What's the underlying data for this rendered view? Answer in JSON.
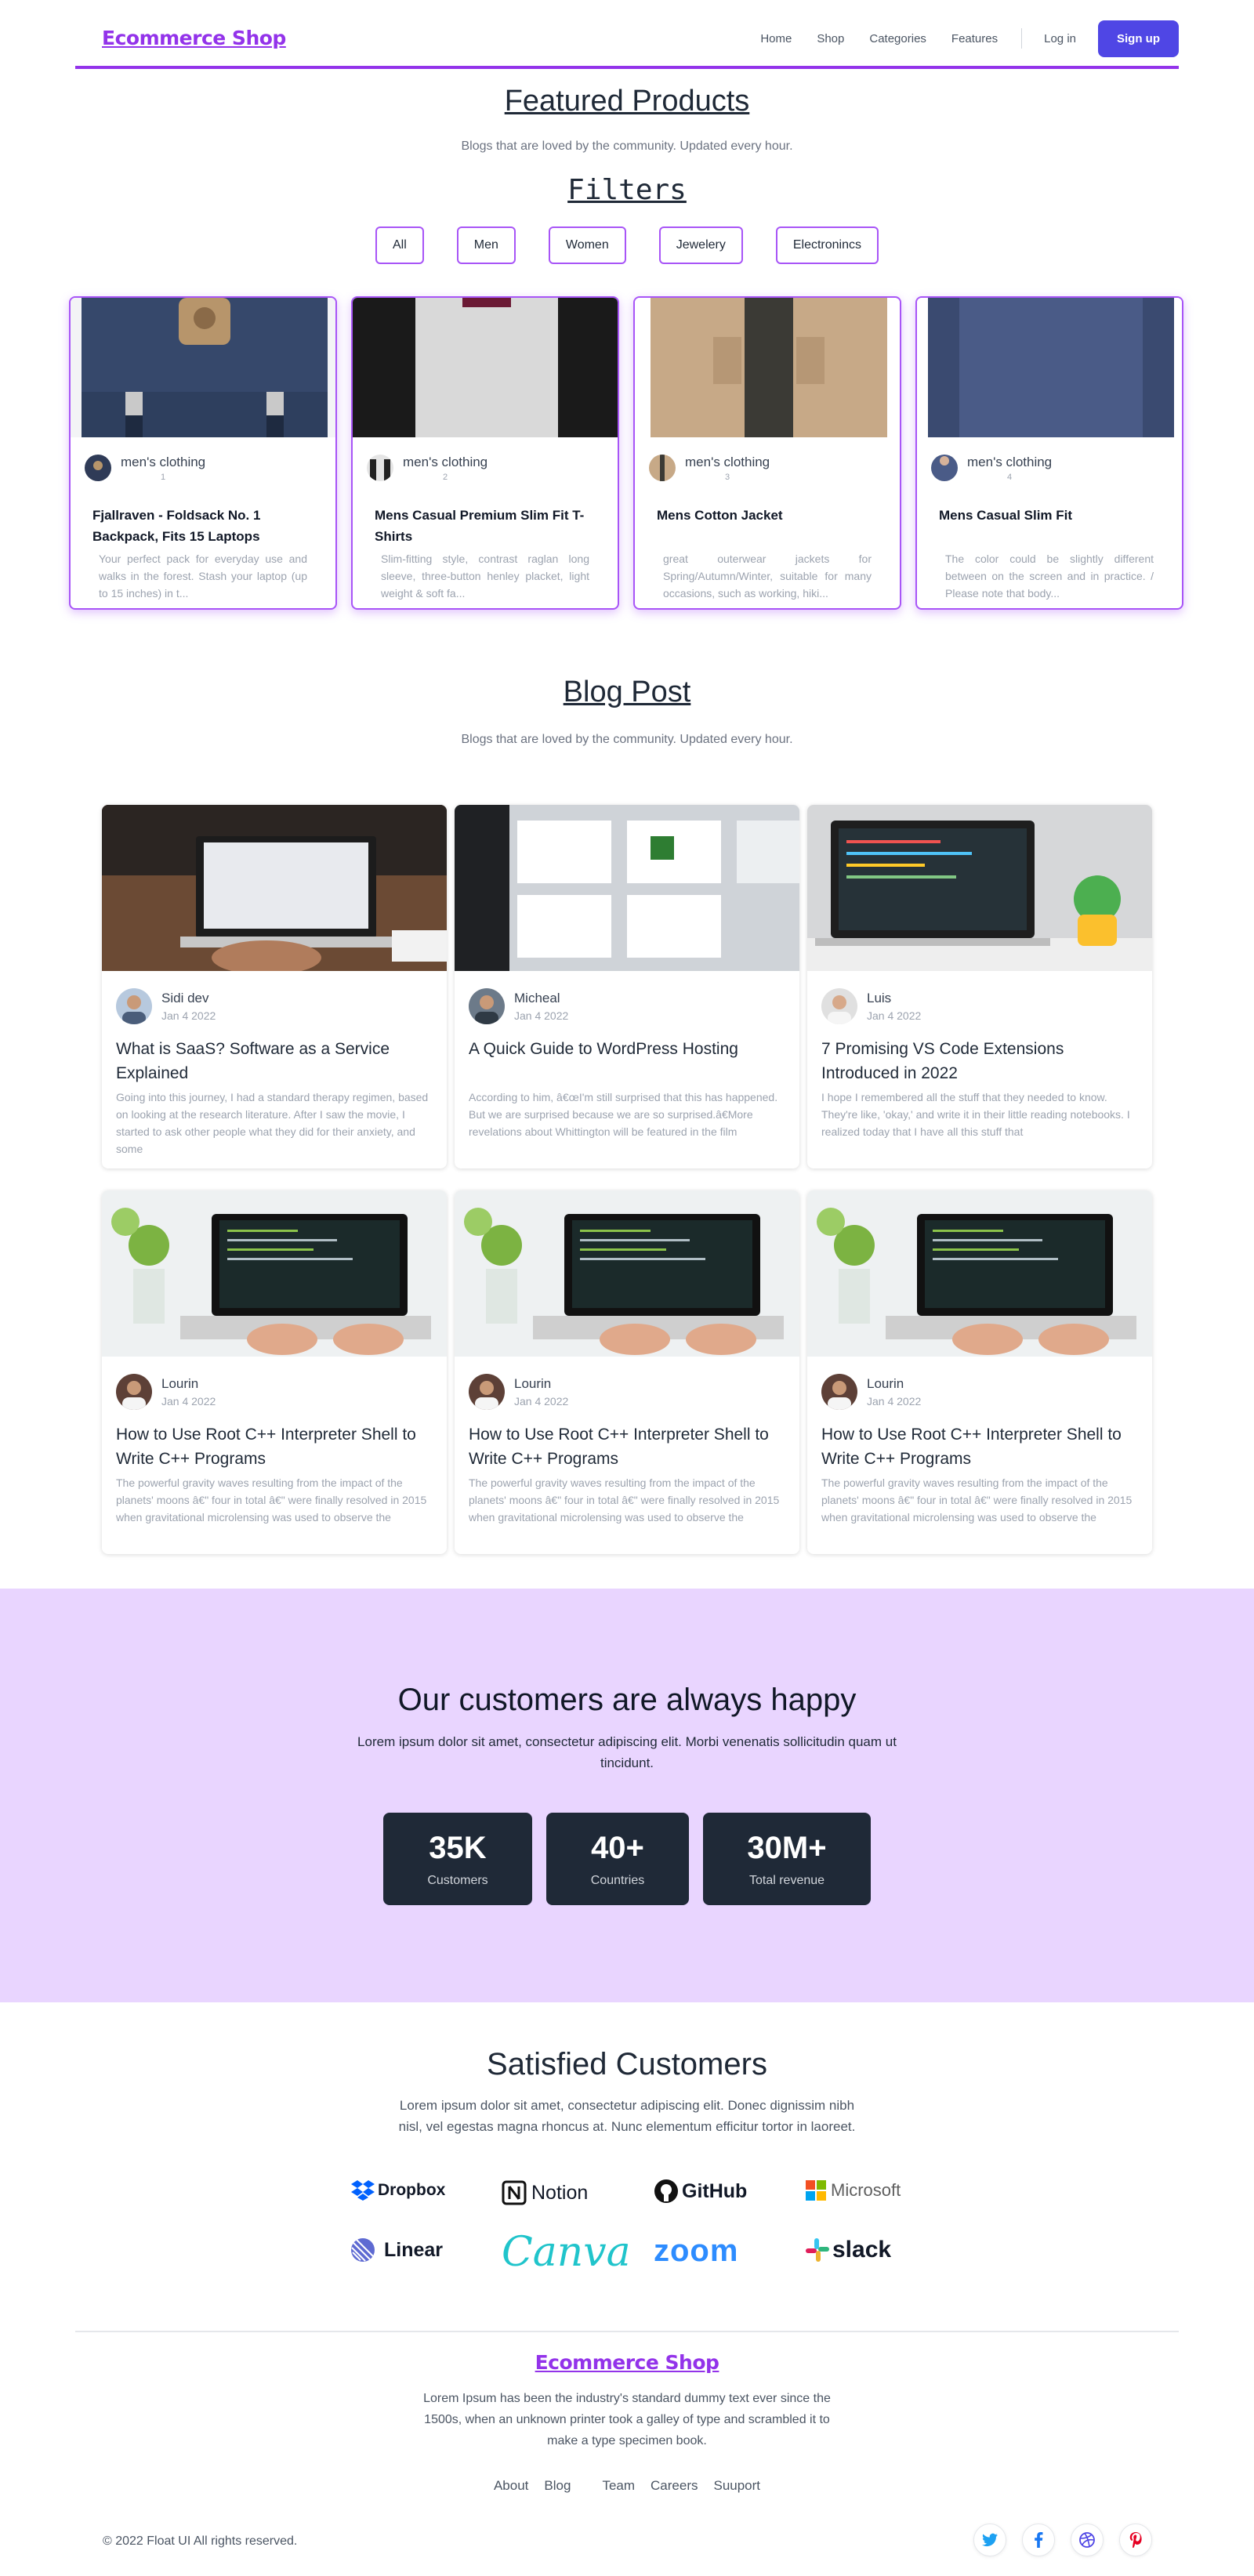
{
  "nav": {
    "brand": "Ecommerce Shop",
    "links": [
      "Home",
      "Shop",
      "Categories",
      "Features"
    ],
    "login": "Log in",
    "signup": "Sign up"
  },
  "featured": {
    "title": "Featured Products",
    "subtitle": "Blogs that are loved by the community. Updated every hour."
  },
  "filters": {
    "title": "Filters",
    "items": [
      "All",
      "Men",
      "Women",
      "Jewelery",
      "Electronincs"
    ]
  },
  "products": [
    {
      "category": "men's clothing",
      "id": "1",
      "title": "Fjallraven - Foldsack No. 1 Backpack, Fits 15 Laptops",
      "desc": "Your perfect pack for everyday use and walks in the forest. Stash your laptop (up to 15 inches) in t..."
    },
    {
      "category": "men's clothing",
      "id": "2",
      "title": "Mens Casual Premium Slim Fit T-Shirts",
      "desc": "Slim-fitting style, contrast raglan long sleeve, three-button henley placket, light weight & soft fa..."
    },
    {
      "category": "men's clothing",
      "id": "3",
      "title": "Mens Cotton Jacket",
      "desc": "great outerwear jackets for Spring/Autumn/Winter, suitable for many occasions, such as working, hiki..."
    },
    {
      "category": "men's clothing",
      "id": "4",
      "title": "Mens Casual Slim Fit",
      "desc": "The color could be slightly different between on the screen and in practice. / Please note that body..."
    }
  ],
  "blog": {
    "title": "Blog Post",
    "subtitle": "Blogs that are loved by the community. Updated every hour.",
    "posts": [
      {
        "author": "Sidi dev",
        "date": "Jan 4 2022",
        "title": "What is SaaS? Software as a Service Explained",
        "desc": "Going into this journey, I had a standard therapy regimen, based on looking at the research literature. After I saw the movie, I started to ask other people what they did for their anxiety, and some"
      },
      {
        "author": "Micheal",
        "date": "Jan 4 2022",
        "title": "A Quick Guide to WordPress Hosting",
        "desc": "According to him, â€œI'm still surprised that this has happened. But we are surprised because we are so surprised.â€More revelations about Whittington will be featured in the film"
      },
      {
        "author": "Luis",
        "date": "Jan 4 2022",
        "title": "7 Promising VS Code Extensions Introduced in 2022",
        "desc": "I hope I remembered all the stuff that they needed to know. They're like, 'okay,' and write it in their little reading notebooks. I realized today that I have all this stuff that"
      },
      {
        "author": "Lourin",
        "date": "Jan 4 2022",
        "title": "How to Use Root C++ Interpreter Shell to Write C++ Programs",
        "desc": "The powerful gravity waves resulting from the impact of the planets' moons â€\" four in total â€\" were finally resolved in 2015 when gravitational microlensing was used to observe the"
      },
      {
        "author": "Lourin",
        "date": "Jan 4 2022",
        "title": "How to Use Root C++ Interpreter Shell to Write C++ Programs",
        "desc": "The powerful gravity waves resulting from the impact of the planets' moons â€\" four in total â€\" were finally resolved in 2015 when gravitational microlensing was used to observe the"
      },
      {
        "author": "Lourin",
        "date": "Jan 4 2022",
        "title": "How to Use Root C++ Interpreter Shell to Write C++ Programs",
        "desc": "The powerful gravity waves resulting from the impact of the planets' moons â€\" four in total â€\" were finally resolved in 2015 when gravitational microlensing was used to observe the"
      }
    ]
  },
  "stats": {
    "title": "Our customers are always happy",
    "text": "Lorem ipsum dolor sit amet, consectetur adipiscing elit. Morbi venenatis sollicitudin quam ut tincidunt.",
    "items": [
      {
        "value": "35K",
        "label": "Customers"
      },
      {
        "value": "40+",
        "label": "Countries"
      },
      {
        "value": "30M+",
        "label": "Total revenue"
      }
    ]
  },
  "customers": {
    "title": "Satisfied Customers",
    "text": "Lorem ipsum dolor sit amet, consectetur adipiscing elit. Donec dignissim nibh nisl, vel egestas magna rhoncus at. Nunc elementum efficitur tortor in laoreet.",
    "logos": [
      "Dropbox",
      "Notion",
      "GitHub",
      "Microsoft",
      "Linear",
      "Canva",
      "zoom",
      "slack"
    ]
  },
  "footer": {
    "brand": "Ecommerce Shop",
    "text": "Lorem Ipsum has been the industry's standard dummy text ever since the 1500s, when an unknown printer took a galley of type and scrambled it to make a type specimen book.",
    "links": [
      "About",
      "Blog",
      "",
      "Team",
      "Careers",
      "Suuport"
    ],
    "copyright": "© 2022 Float UI All rights reserved.",
    "socials": [
      "twitter-icon",
      "facebook-icon",
      "dribbble-icon",
      "pinterest-icon"
    ]
  },
  "colors": {
    "accent": "#9333ea",
    "signup": "#4f46e5",
    "stats_bg": "#e9d5ff",
    "stat_card": "#1f2937"
  }
}
